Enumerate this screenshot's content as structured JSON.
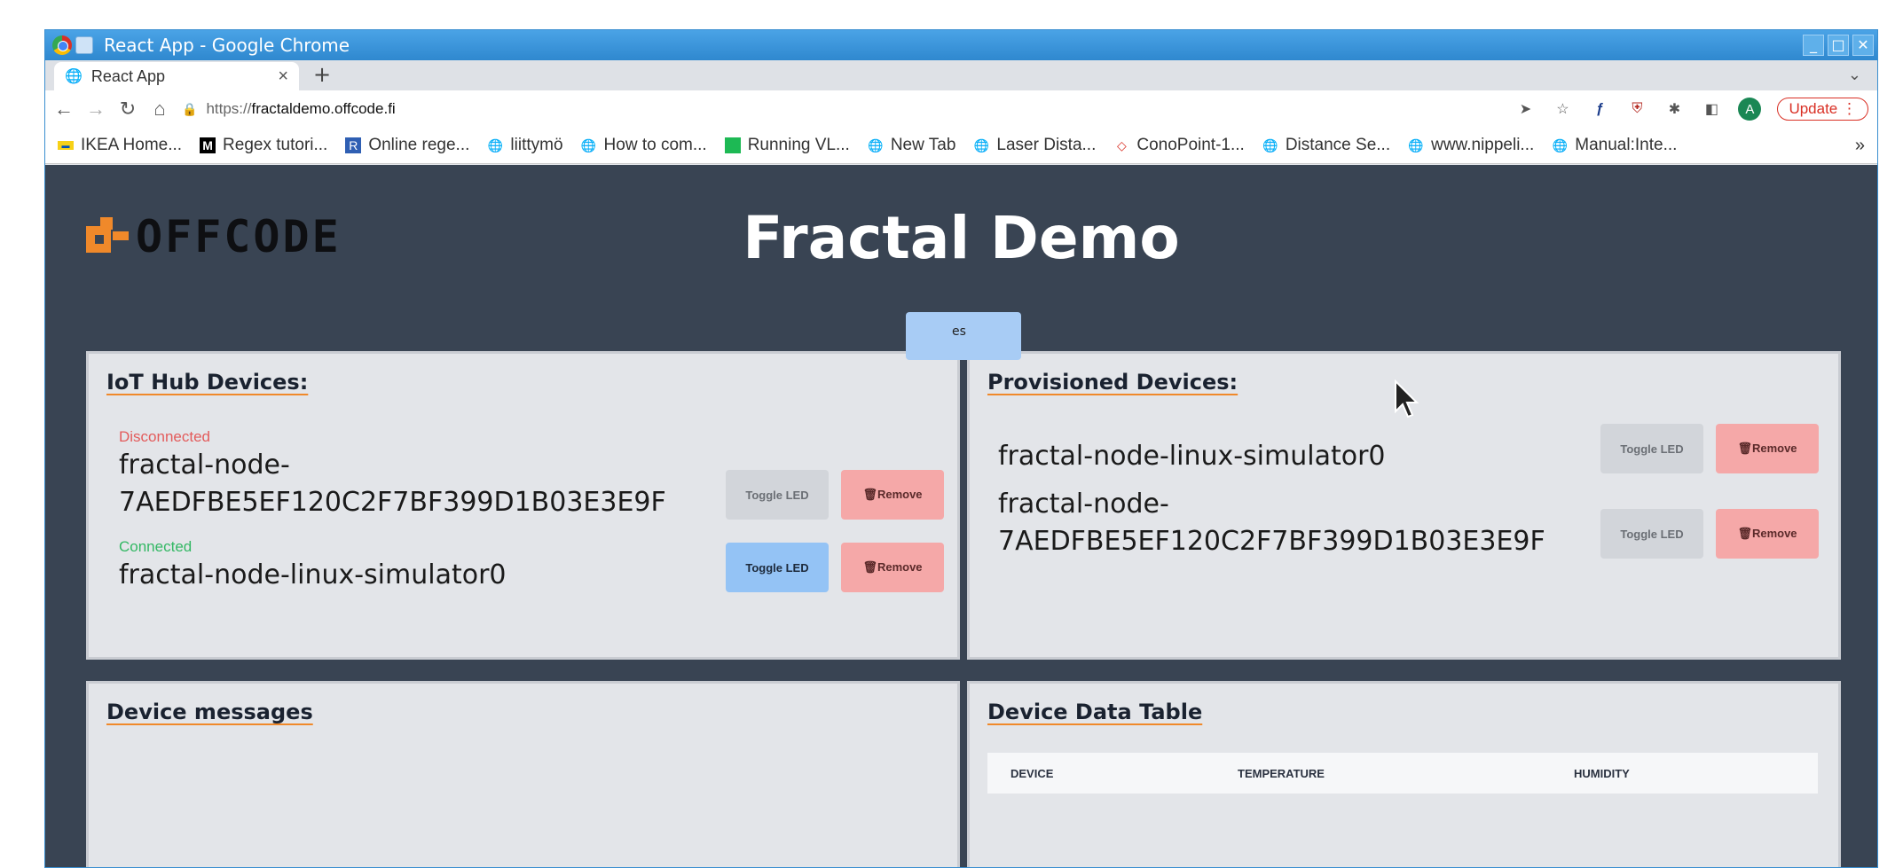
{
  "window": {
    "title": "React App - Google Chrome",
    "controls": [
      "_",
      "□",
      "✕"
    ]
  },
  "tab": {
    "title": "React App",
    "close": "×",
    "new_tab": "+"
  },
  "toolbar": {
    "url_scheme": "https://",
    "url_host": "fractaldemo.offcode.fi",
    "update_label": "Update",
    "avatar_letter": "A"
  },
  "bookmarks": [
    {
      "label": "IKEA Home...",
      "icon": "ikea-icon"
    },
    {
      "label": "Regex tutori...",
      "icon": "medium-icon"
    },
    {
      "label": "Online rege...",
      "icon": "r-icon"
    },
    {
      "label": "liittymö",
      "icon": "globe-icon"
    },
    {
      "label": "How to com...",
      "icon": "globe-icon"
    },
    {
      "label": "Running VL...",
      "icon": "green-icon"
    },
    {
      "label": "New Tab",
      "icon": "globe-icon"
    },
    {
      "label": "Laser Dista...",
      "icon": "globe-icon"
    },
    {
      "label": "ConoPoint-1...",
      "icon": "diamond-icon"
    },
    {
      "label": "Distance Se...",
      "icon": "globe-icon"
    },
    {
      "label": "www.nippeli...",
      "icon": "globe-icon"
    },
    {
      "label": "Manual:Inte...",
      "icon": "globe-icon"
    }
  ],
  "bookmarks_more": "»",
  "app": {
    "logo_text": "OFFCODE",
    "title": "Fractal Demo",
    "strip_button_text": "es"
  },
  "iot_hub": {
    "heading": "IoT Hub Devices:",
    "devices": [
      {
        "status": "Disconnected",
        "name_line1": "fractal-node-",
        "name_line2": "7AEDFBE5EF120C2F7BF399D1B03E3E9F",
        "led_label": "Toggle LED",
        "remove_label": "🗑Remove"
      },
      {
        "status": "Connected",
        "name_line1": "fractal-node-linux-simulator0",
        "name_line2": "",
        "led_label": "Toggle LED",
        "remove_label": "🗑Remove"
      }
    ]
  },
  "provisioned": {
    "heading": "Provisioned Devices:",
    "devices": [
      {
        "name_line1": "fractal-node-linux-simulator0",
        "name_line2": "",
        "led_label": "Toggle LED",
        "remove_label": "🗑Remove"
      },
      {
        "name_line1": "fractal-node-",
        "name_line2": "7AEDFBE5EF120C2F7BF399D1B03E3E9F",
        "led_label": "Toggle LED",
        "remove_label": "🗑Remove"
      }
    ]
  },
  "messages": {
    "heading": "Device messages"
  },
  "data_table": {
    "heading": "Device Data Table",
    "columns": [
      "DEVICE",
      "TEMPERATURE",
      "HUMIDITY"
    ]
  }
}
